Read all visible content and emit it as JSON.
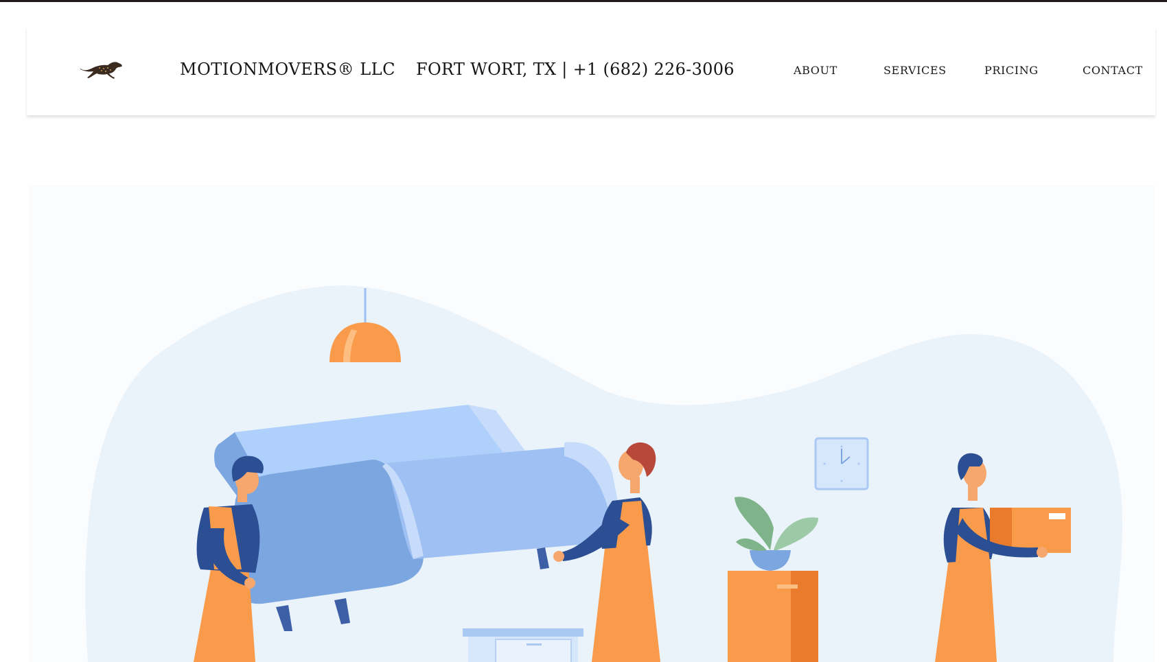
{
  "header": {
    "brand": "MOTIONMOVERS® LLC",
    "location_phone": "FORT WORT, TX | +1 (682) 226-3006",
    "logo_icon": "cheetah-icon"
  },
  "nav": {
    "items": [
      {
        "label": "ABOUT"
      },
      {
        "label": "SERVICES"
      },
      {
        "label": "PRICING"
      },
      {
        "label": "CONTACT"
      }
    ]
  },
  "hero": {
    "illustration": "movers-carrying-sofa-illustration"
  },
  "colors": {
    "accent_orange": "#F99B4B",
    "navy": "#2C4F93",
    "sofa_blue": "#9EC0F2",
    "blob": "#EAF2FA",
    "top_bar": "#241718"
  }
}
